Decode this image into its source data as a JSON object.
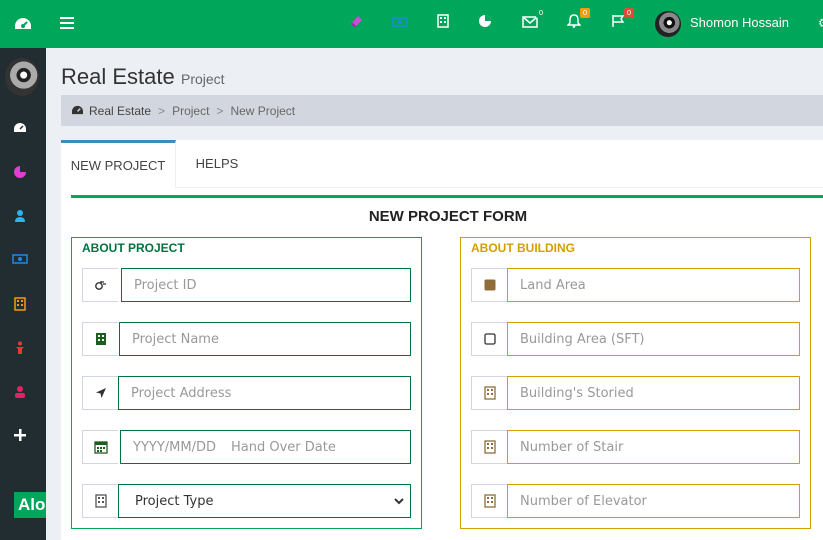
{
  "colors": {
    "brand": "#00a65a",
    "sidebar": "#222d32",
    "building_accent": "#d69d00",
    "project_accent": "#00733e"
  },
  "sidebar": {
    "logo_text": "Alo",
    "icons": [
      "dashboard-icon",
      "pie-chart-icon",
      "user-icon",
      "money-icon",
      "building-icon",
      "person-icon",
      "group-icon",
      "plus-icon"
    ]
  },
  "header": {
    "icons": [
      "eraser-icon",
      "money-icon",
      "building-icon",
      "pie-chart-icon",
      "envelope-icon",
      "bell-icon",
      "flag-icon"
    ],
    "badges": {
      "messages": "0",
      "notifications": "0",
      "tasks": "0"
    },
    "user_name": "Shomon Hossain"
  },
  "page": {
    "title": "Real Estate",
    "subtitle": "Project"
  },
  "breadcrumb": {
    "home": "Real Estate",
    "sep": ">",
    "section": "Project",
    "current": "New Project"
  },
  "tabs": {
    "new_project": "NEW PROJECT",
    "helps": "HELPS"
  },
  "form": {
    "title": "NEW PROJECT FORM",
    "about_project": {
      "title": "ABOUT PROJECT",
      "project_id": "Project ID",
      "project_name": "Project Name",
      "project_address": "Project Address",
      "date_format": "YYYY/MM/DD",
      "hand_over": "Hand Over Date",
      "project_type": "Project Type"
    },
    "about_building": {
      "title": "ABOUT BUILDING",
      "land_area": "Land Area",
      "building_area": "Building Area (SFT)",
      "storied": "Building's Storied",
      "stair": "Number of Stair",
      "elevator": "Number of Elevator"
    }
  }
}
